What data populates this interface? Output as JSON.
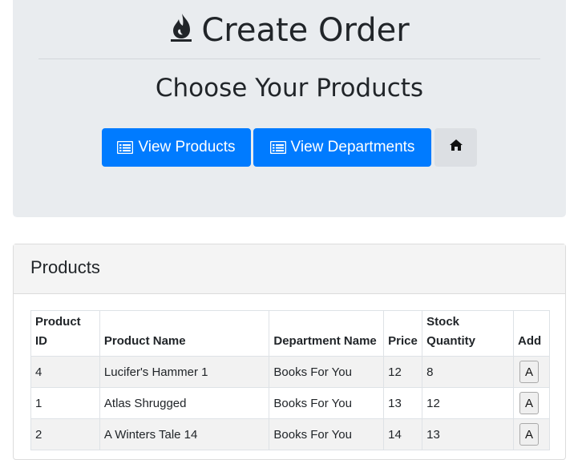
{
  "header": {
    "title": "Create Order",
    "title_icon": "flame-icon",
    "subtitle": "Choose Your Products"
  },
  "buttons": {
    "view_products": "View Products",
    "view_departments": "View Departments",
    "home_icon": "home-icon",
    "list_icon": "list-alt-icon"
  },
  "colors": {
    "primary": "#007bff",
    "jumbotron_bg": "#e9ecef"
  },
  "products_card": {
    "title": "Products",
    "columns": {
      "id": "Product ID",
      "name": "Product Name",
      "department": "Department Name",
      "price": "Price",
      "stock": "Stock Quantity",
      "add": "Add"
    },
    "rows": [
      {
        "id": "4",
        "name": "Lucifer's Hammer 1",
        "department": "Books For You",
        "price": "12",
        "stock": "8",
        "add_label": "A"
      },
      {
        "id": "1",
        "name": "Atlas Shrugged",
        "department": "Books For You",
        "price": "13",
        "stock": "12",
        "add_label": "A"
      },
      {
        "id": "2",
        "name": "A Winters Tale 14",
        "department": "Books For You",
        "price": "14",
        "stock": "13",
        "add_label": "A"
      }
    ]
  }
}
